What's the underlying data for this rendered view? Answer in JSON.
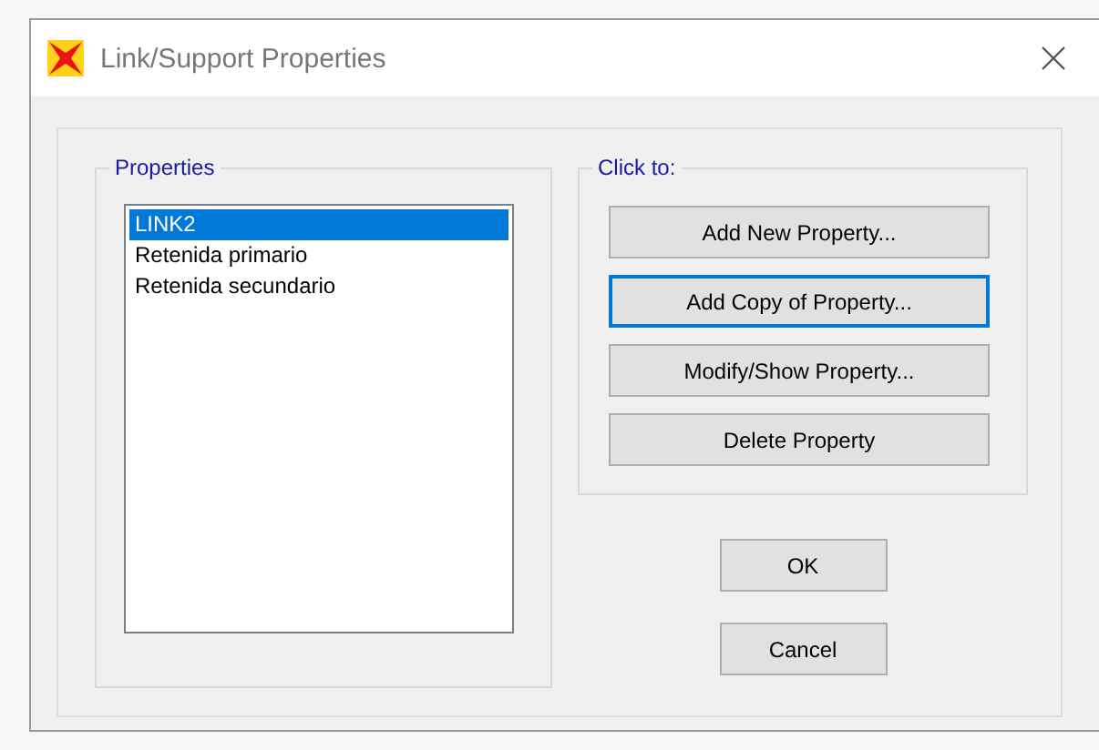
{
  "window": {
    "title": "Link/Support Properties"
  },
  "properties": {
    "label": "Properties",
    "items": [
      {
        "label": "LINK2",
        "selected": true
      },
      {
        "label": "Retenida primario",
        "selected": false
      },
      {
        "label": "Retenida secundario",
        "selected": false
      }
    ]
  },
  "click_to": {
    "label": "Click to:",
    "buttons": [
      {
        "label": "Add New Property...",
        "focused": false
      },
      {
        "label": "Add Copy of Property...",
        "focused": true
      },
      {
        "label": "Modify/Show Property...",
        "focused": false
      },
      {
        "label": "Delete Property",
        "focused": false
      }
    ]
  },
  "buttons": [
    {
      "label": "OK"
    },
    {
      "label": "Cancel"
    }
  ]
}
